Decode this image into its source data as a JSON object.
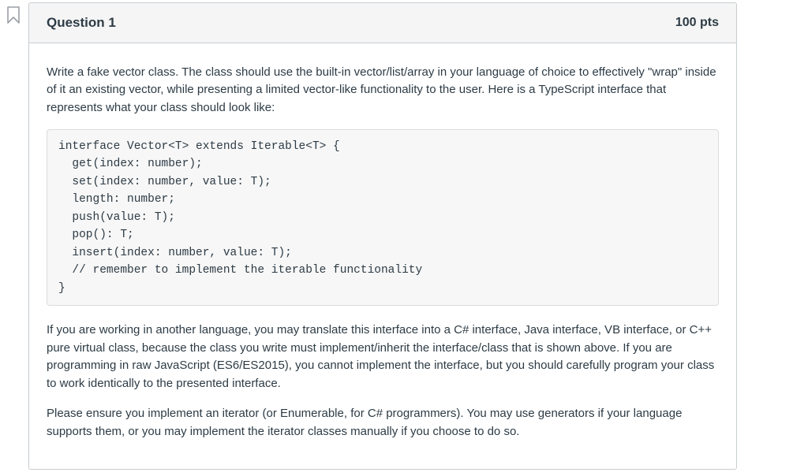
{
  "header": {
    "title": "Question 1",
    "points": "100 pts"
  },
  "body": {
    "intro": "Write a fake vector class. The class should use the built-in vector/list/array in your language of choice to effectively \"wrap\" inside of it an existing vector, while presenting a limited vector-like functionality to the user. Here is a TypeScript interface that represents what your class should look like:",
    "code": "interface Vector<T> extends Iterable<T> {\n  get(index: number);\n  set(index: number, value: T);\n  length: number;\n  push(value: T);\n  pop(): T;\n  insert(index: number, value: T);\n  // remember to implement the iterable functionality\n}",
    "para2": "If you are working in another language, you may translate this interface into a C# interface, Java interface, VB interface, or C++ pure virtual class, because the class you write must implement/inherit the interface/class that is shown above. If you are programming in raw JavaScript (ES6/ES2015), you cannot implement the interface, but you should carefully program your class to work identically to the presented interface.",
    "para3": "Please ensure you implement an iterator (or Enumerable, for C# programmers). You may use generators if your language supports them, or you may implement the iterator classes manually if you choose to do so."
  }
}
